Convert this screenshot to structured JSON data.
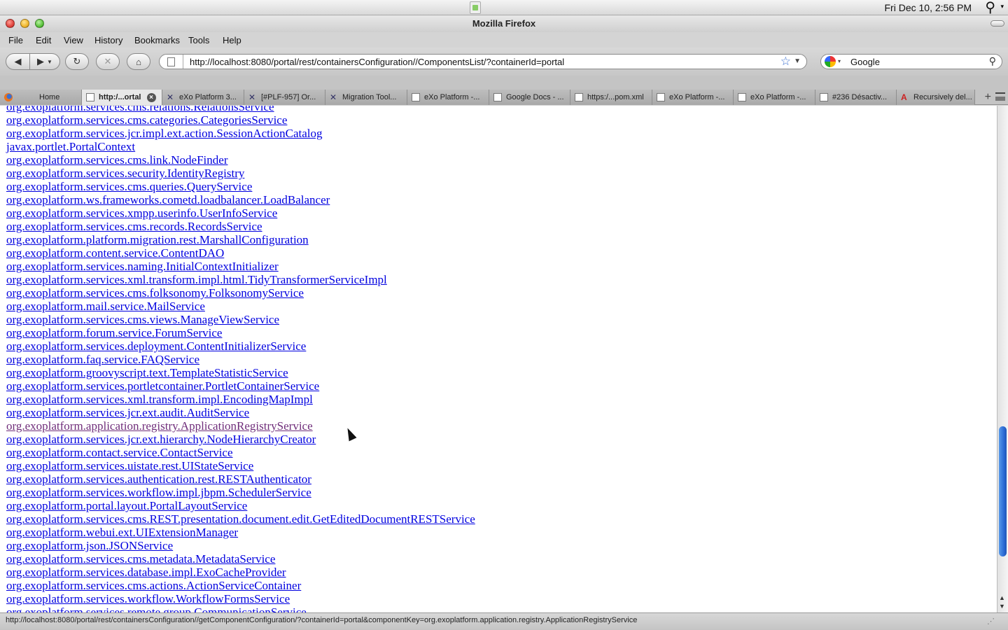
{
  "menubar": {
    "clock": "Fri Dec 10,  2:56 PM"
  },
  "window": {
    "title": "Mozilla Firefox"
  },
  "menus": [
    {
      "label": "File"
    },
    {
      "label": "Edit"
    },
    {
      "label": "View"
    },
    {
      "label": "History"
    },
    {
      "label": "Bookmarks"
    },
    {
      "label": "Tools"
    },
    {
      "label": "Help"
    }
  ],
  "toolbar": {
    "url": "http://localhost:8080/portal/rest/containersConfiguration//ComponentsList/?containerId=portal",
    "search_value": "Google"
  },
  "tabs": [
    {
      "label": "Home",
      "icon": "firefox-icon"
    },
    {
      "label": "http:/...ortal",
      "icon": "page-icon",
      "active": true
    },
    {
      "label": "eXo Platform 3...",
      "icon": "exo-icon"
    },
    {
      "label": "[#PLF-957] Or...",
      "icon": "exo-icon"
    },
    {
      "label": "Migration Tool...",
      "icon": "exo-icon"
    },
    {
      "label": "eXo Platform -...",
      "icon": "page-icon"
    },
    {
      "label": "Google Docs - ...",
      "icon": "page-icon"
    },
    {
      "label": "https:/...pom.xml",
      "icon": "page-icon"
    },
    {
      "label": "eXo Platform -...",
      "icon": "page-icon"
    },
    {
      "label": "eXo Platform -...",
      "icon": "page-icon"
    },
    {
      "label": "#236 Désactiv...",
      "icon": "page-icon"
    },
    {
      "label": "Recursively del...",
      "icon": "abstract-icon"
    }
  ],
  "services": [
    "org.exoplatform.services.cms.relations.RelationsService",
    "org.exoplatform.services.cms.categories.CategoriesService",
    "org.exoplatform.services.jcr.impl.ext.action.SessionActionCatalog",
    "javax.portlet.PortalContext",
    "org.exoplatform.services.cms.link.NodeFinder",
    "org.exoplatform.services.security.IdentityRegistry",
    "org.exoplatform.services.cms.queries.QueryService",
    "org.exoplatform.ws.frameworks.cometd.loadbalancer.LoadBalancer",
    "org.exoplatform.services.xmpp.userinfo.UserInfoService",
    "org.exoplatform.services.cms.records.RecordsService",
    "org.exoplatform.platform.migration.rest.MarshallConfiguration",
    "org.exoplatform.content.service.ContentDAO",
    "org.exoplatform.services.naming.InitialContextInitializer",
    "org.exoplatform.services.xml.transform.impl.html.TidyTransformerServiceImpl",
    "org.exoplatform.services.cms.folksonomy.FolksonomyService",
    "org.exoplatform.mail.service.MailService",
    "org.exoplatform.services.cms.views.ManageViewService",
    "org.exoplatform.forum.service.ForumService",
    "org.exoplatform.services.deployment.ContentInitializerService",
    "org.exoplatform.faq.service.FAQService",
    "org.exoplatform.groovyscript.text.TemplateStatisticService",
    "org.exoplatform.services.portletcontainer.PortletContainerService",
    "org.exoplatform.services.xml.transform.impl.EncodingMapImpl",
    "org.exoplatform.services.jcr.ext.audit.AuditService",
    "org.exoplatform.application.registry.ApplicationRegistryService",
    "org.exoplatform.services.jcr.ext.hierarchy.NodeHierarchyCreator",
    "org.exoplatform.contact.service.ContactService",
    "org.exoplatform.services.uistate.rest.UIStateService",
    "org.exoplatform.services.authentication.rest.RESTAuthenticator",
    "org.exoplatform.services.workflow.impl.jbpm.SchedulerService",
    "org.exoplatform.portal.layout.PortalLayoutService",
    "org.exoplatform.services.cms.REST.presentation.document.edit.GetEditedDocumentRESTService",
    "org.exoplatform.webui.ext.UIExtensionManager",
    "org.exoplatform.json.JSONService",
    "org.exoplatform.services.cms.metadata.MetadataService",
    "org.exoplatform.services.database.impl.ExoCacheProvider",
    "org.exoplatform.services.cms.actions.ActionServiceContainer",
    "org.exoplatform.services.workflow.WorkflowFormsService",
    "org.exoplatform.services.remote.group.CommunicationService"
  ],
  "visited_index": 24,
  "status": {
    "text": "http://localhost:8080/portal/rest/containersConfiguration//getComponentConfiguration/?containerId=portal&componentKey=org.exoplatform.application.registry.ApplicationRegistryService"
  },
  "colors": {
    "link": "#0000e0",
    "visited_link": "#6f2d7a",
    "scroll_thumb": "#2f6dd6"
  }
}
